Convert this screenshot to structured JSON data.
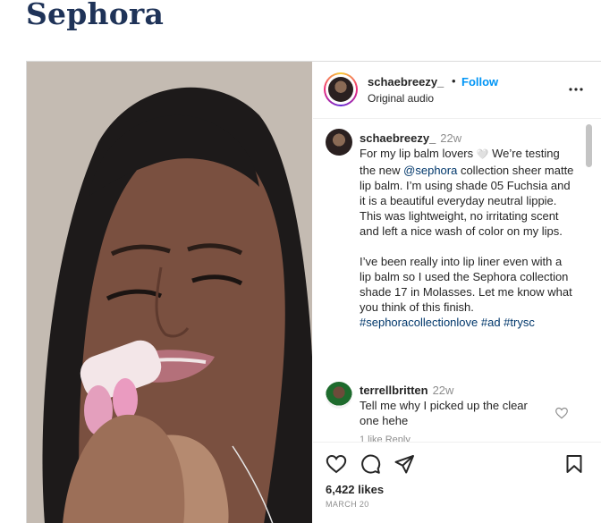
{
  "page": {
    "heading": "Sephora"
  },
  "post": {
    "username": "schaebreezy_",
    "separator": "•",
    "follow_label": "Follow",
    "audio": "Original audio",
    "more_icon": "more-horizontal-icon"
  },
  "caption": {
    "username": "schaebreezy_",
    "time": "22w",
    "text_part1": "For my lip balm lovers",
    "heart": "🤍",
    "text_part2": " We’re testing the new ",
    "mention": "@sephora",
    "text_part3": " collection sheer matte lip balm. I’m using shade 05 Fuchsia and it is a beautiful everyday neutral lippie. This was lightweight, no irritating scent and left a nice wash of color on my lips.",
    "paragraph2": "I’ve been really into lip liner even with a lip balm so I used the Sephora collection shade 17 in Molasses. Let me know what you think of this finish.",
    "hashtags": "#sephoracollectionlove #ad #trysc"
  },
  "comment": {
    "username": "terrellbritten",
    "time": "22w",
    "text": "Tell me why I picked up the clear one hehe",
    "sub": "1 like  Reply"
  },
  "actions": {
    "likes": "6,422 likes",
    "date": "MARCH 20"
  },
  "colors": {
    "heading": "#1f3358",
    "follow": "#0095f6",
    "link": "#00376b"
  }
}
